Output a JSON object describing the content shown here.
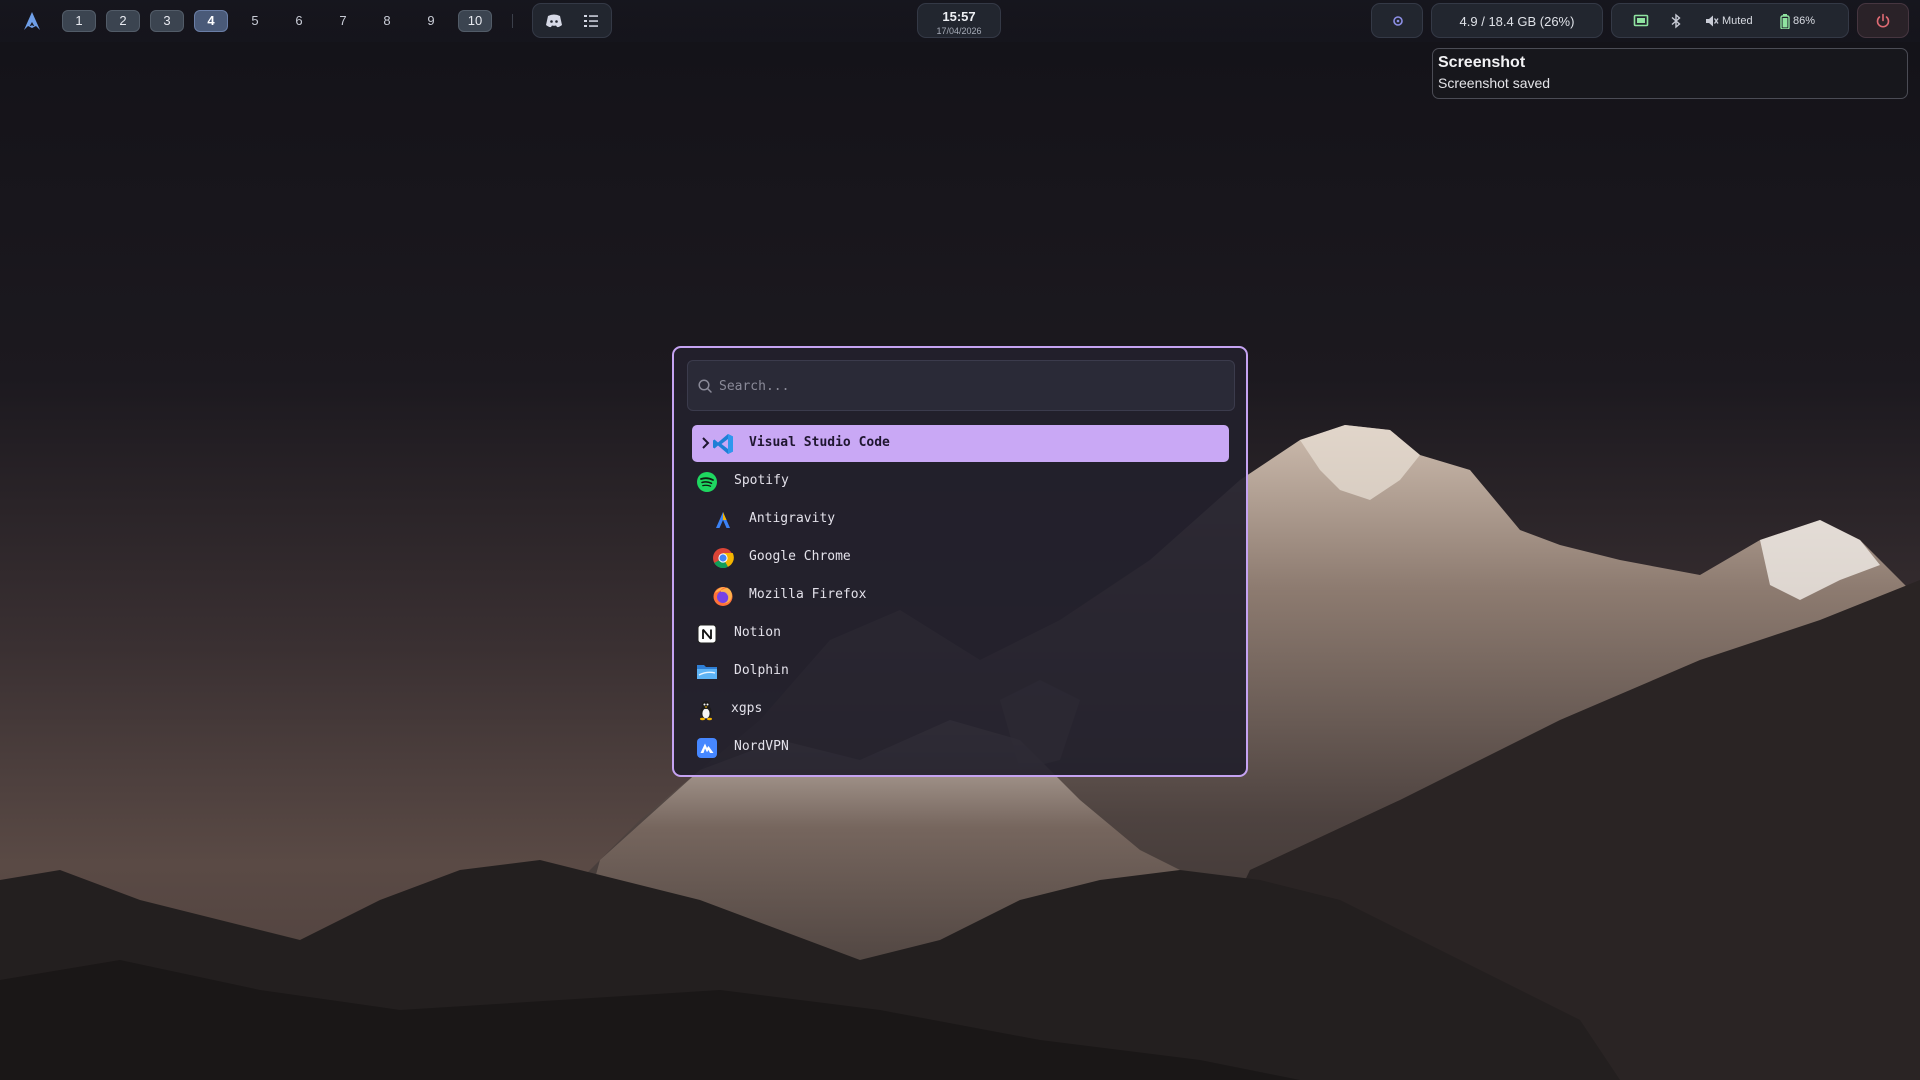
{
  "colors": {
    "accent": "#c9a8f5",
    "launcher_border": "#c5a3f2",
    "bar_bg": "#22262f",
    "power": "#e06b74"
  },
  "topbar": {
    "logo_icon": "arch-logo-icon",
    "workspaces": [
      {
        "label": "1",
        "state": "occupied"
      },
      {
        "label": "2",
        "state": "occupied"
      },
      {
        "label": "3",
        "state": "occupied"
      },
      {
        "label": "4",
        "state": "active"
      },
      {
        "label": "5",
        "state": "empty"
      },
      {
        "label": "6",
        "state": "empty"
      },
      {
        "label": "7",
        "state": "empty"
      },
      {
        "label": "8",
        "state": "empty"
      },
      {
        "label": "9",
        "state": "empty"
      },
      {
        "label": "10",
        "state": "occupied"
      }
    ],
    "tray_apps": [
      "discord-icon",
      "task-list-icon"
    ],
    "clock": {
      "time": "15:57",
      "date": "17/04/2026"
    },
    "memory": "4.9 / 18.4 GB (26%)",
    "status": {
      "volume": "Muted",
      "battery": "86%"
    }
  },
  "notification": {
    "title": "Screenshot",
    "body": "Screenshot saved"
  },
  "launcher": {
    "search_placeholder": "Search...",
    "items": [
      {
        "label": "Visual Studio Code",
        "icon": "vscode-icon",
        "selected": true
      },
      {
        "label": "Spotify",
        "icon": "spotify-icon"
      },
      {
        "label": "Antigravity",
        "icon": "antigravity-icon"
      },
      {
        "label": "Google Chrome",
        "icon": "chrome-icon"
      },
      {
        "label": "Mozilla Firefox",
        "icon": "firefox-icon"
      },
      {
        "label": "Notion",
        "icon": "notion-icon"
      },
      {
        "label": "Dolphin",
        "icon": "dolphin-icon"
      },
      {
        "label": "xgps",
        "icon": "tux-icon"
      },
      {
        "label": "NordVPN",
        "icon": "nordvpn-icon"
      }
    ]
  }
}
